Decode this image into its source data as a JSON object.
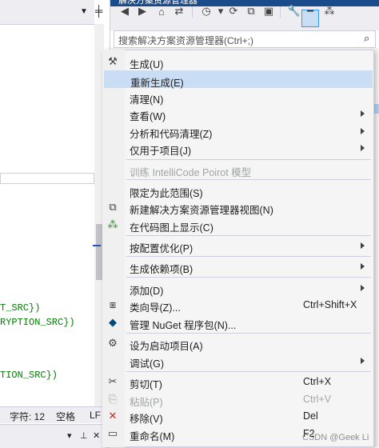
{
  "editor": {
    "code_lines": [
      "T_SRC})",
      "RYPTION_SRC})",
      "TION_SRC})"
    ],
    "status": {
      "char": "字符: 12",
      "space": "空格",
      "lf": "LF"
    }
  },
  "solution_explorer": {
    "title": "解决方案资源管理器",
    "search_placeholder": "搜索解决方案资源管理器(Ctrl+;)"
  },
  "menu": {
    "items": [
      {
        "label": "生成(U)",
        "icon": "build-icon"
      },
      {
        "label": "重新生成(E)",
        "highlighted": true
      },
      {
        "label": "清理(N)"
      },
      {
        "label": "查看(W)",
        "submenu": true
      },
      {
        "label": "分析和代码清理(Z)",
        "submenu": true
      },
      {
        "label": "仅用于项目(J)",
        "submenu": true
      },
      {
        "label": "训练 IntelliCode Poirot 模型",
        "disabled": true
      },
      {
        "label": "限定为此范围(S)"
      },
      {
        "label": "新建解决方案资源管理器视图(N)",
        "icon": "new-view-icon"
      },
      {
        "label": "在代码图上显示(C)",
        "icon": "code-map-icon"
      },
      {
        "label": "按配置优化(P)",
        "submenu": true
      },
      {
        "label": "生成依赖项(B)",
        "submenu": true
      },
      {
        "label": "添加(D)",
        "submenu": true
      },
      {
        "label": "类向导(Z)...",
        "shortcut": "Ctrl+Shift+X",
        "icon": "class-wizard-icon"
      },
      {
        "label": "管理 NuGet 程序包(N)...",
        "icon": "nuget-icon"
      },
      {
        "label": "设为启动项目(A)",
        "icon": "gear-icon"
      },
      {
        "label": "调试(G)",
        "submenu": true
      },
      {
        "label": "剪切(T)",
        "shortcut": "Ctrl+X",
        "icon": "scissors-icon"
      },
      {
        "label": "粘贴(P)",
        "shortcut": "Ctrl+V",
        "icon": "paste-icon",
        "disabled": true
      },
      {
        "label": "移除(V)",
        "shortcut": "Del",
        "icon": "remove-icon"
      },
      {
        "label": "重命名(M)",
        "shortcut": "F2",
        "icon": "rename-icon"
      }
    ]
  },
  "watermark": "CSDN @Geek Li",
  "colors": {
    "highlight": "#c9def5",
    "remove_red": "#c42b1c",
    "accent_blue": "#1a4c8b"
  }
}
